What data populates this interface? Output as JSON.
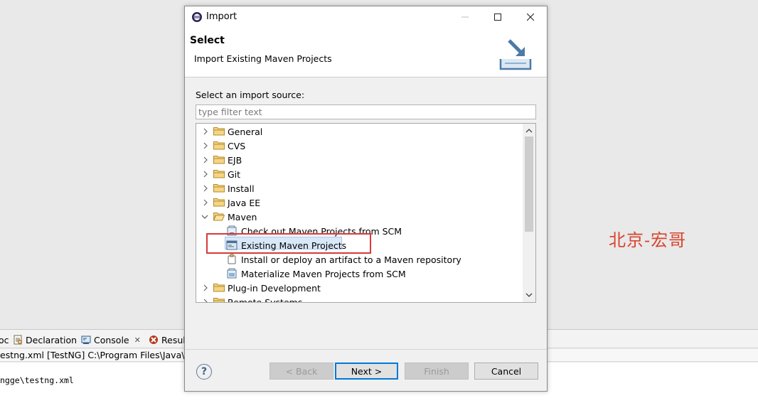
{
  "background": {
    "tabs": [
      {
        "label": "oc"
      },
      {
        "label": "Declaration"
      },
      {
        "label": "Console",
        "close": "✕"
      },
      {
        "label": "Resul"
      }
    ],
    "console_line": "estng.xml [TestNG] C:\\Program Files\\Java\\jre",
    "console_output": "ngge\\testng.xml",
    "watermark": "北京-宏哥"
  },
  "dialog": {
    "title": "Import",
    "header": {
      "title": "Select",
      "description": "Import Existing Maven Projects"
    },
    "source_label": "Select an import source:",
    "filter": {
      "value": "",
      "placeholder": "type filter text"
    },
    "tree": {
      "items": [
        {
          "label": "General",
          "kind": "folder",
          "expanded": false
        },
        {
          "label": "CVS",
          "kind": "folder",
          "expanded": false
        },
        {
          "label": "EJB",
          "kind": "folder",
          "expanded": false
        },
        {
          "label": "Git",
          "kind": "folder",
          "expanded": false
        },
        {
          "label": "Install",
          "kind": "folder",
          "expanded": false
        },
        {
          "label": "Java EE",
          "kind": "folder",
          "expanded": false
        },
        {
          "label": "Maven",
          "kind": "folder",
          "expanded": true
        },
        {
          "label": "Check out Maven Projects from SCM",
          "kind": "wizard"
        },
        {
          "label": "Existing Maven Projects",
          "kind": "wizard",
          "selected": true
        },
        {
          "label": "Install or deploy an artifact to a Maven repository",
          "kind": "wizard"
        },
        {
          "label": "Materialize Maven Projects from SCM",
          "kind": "wizard"
        },
        {
          "label": "Plug-in Development",
          "kind": "folder",
          "expanded": false
        },
        {
          "label": "Remote Systems",
          "kind": "folder",
          "expanded": false
        }
      ]
    },
    "buttons": {
      "help": "?",
      "back": "< Back",
      "next": "Next >",
      "finish": "Finish",
      "cancel": "Cancel"
    }
  },
  "colors": {
    "selection_fill": "#d9e8f8",
    "highlight_outline": "#d83a3a",
    "folder": "#e8c46a",
    "watermark": "#d9442f"
  }
}
